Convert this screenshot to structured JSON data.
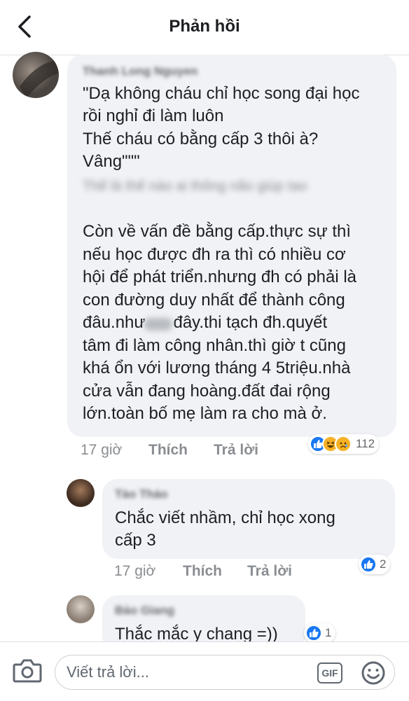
{
  "header": {
    "title": "Phản hồi"
  },
  "main_comment": {
    "author": "Thanh Long Nguyen",
    "lines": [
      "\"Dạ không cháu chỉ học song đại học",
      "rồi nghỉ đi làm luôn",
      "Thế cháu có bằng cấp 3 thôi à?",
      "Vâng\"\"\""
    ],
    "blurred_line": "Thế là thế nào ai thông não giúp tao",
    "paragraph": [
      "Còn về vấn đề bằng cấp.thực sự thì",
      "nếu học được đh ra thì có nhiều cơ",
      "hội để phát triển.nhưng đh có phải là",
      "con đường duy nhất để thành công",
      "đâu.như      đây.thi tạch đh.quyết",
      "tâm đi làm công nhân.thì giờ t cũng",
      "khá ổn với lương tháng 4 5triệu.nhà",
      "cửa vẫn đang hoàng.đất đai rộng",
      "lớn.toàn bố mẹ làm ra cho mà ở."
    ],
    "time": "17 giờ",
    "like_label": "Thích",
    "reply_label": "Trả lời",
    "reaction_count": "112",
    "reactions": [
      "like-icon",
      "haha-icon",
      "sad-icon"
    ]
  },
  "reply1": {
    "author": "Tào Tháo",
    "lines": [
      "Chắc viết nhầm, chỉ học xong",
      "cấp 3"
    ],
    "time": "17 giờ",
    "like_label": "Thích",
    "reply_label": "Trả lời",
    "reaction_count": "2"
  },
  "reply2": {
    "author": "Bảo Giang",
    "text": "Thắc mắc y chang =))",
    "reaction_count": "1"
  },
  "composer": {
    "placeholder": "Viết trả lời...",
    "gif_label": "GIF"
  },
  "colors": {
    "like_blue": "#1877f2",
    "bubble_gray": "#f0f2f5",
    "meta_gray": "#8a8d91"
  }
}
